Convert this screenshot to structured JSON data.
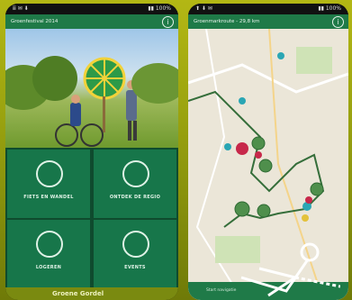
{
  "left_phone": {
    "status_left": "ⅲ ✉ ⬇",
    "status_right": "▮▮ 100%",
    "app_title": "Groenfestival 2014",
    "tiles": [
      {
        "label": "FIETS EN WANDEL",
        "icon": "route-icon"
      },
      {
        "label": "ONTDEK DE REGIO",
        "icon": "map-pin-icon"
      },
      {
        "label": "LOGEREN",
        "icon": "bed-icon"
      },
      {
        "label": "EVENTS",
        "icon": "calendar-icon"
      }
    ],
    "footer_text": "Groene Gordel"
  },
  "right_phone": {
    "status_left": "⬆ ⬇ ✉",
    "status_right": "▮▮ 100%",
    "app_title": "Groenmarkroute - 29,8 km",
    "bottom_bar": "Start navigatie"
  },
  "colors": {
    "brand_green": "#1f7a48",
    "tile_green": "#17764a",
    "background": "#9fa512"
  }
}
